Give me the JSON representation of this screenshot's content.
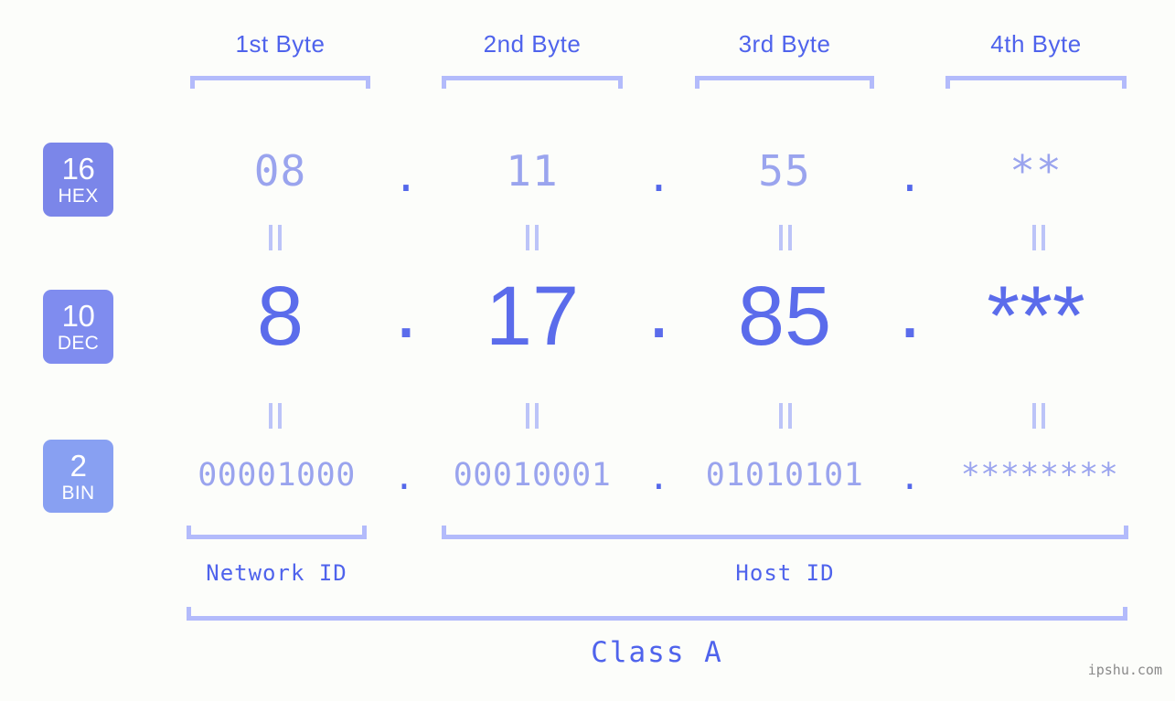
{
  "theme": {
    "background": "#fcfdfa",
    "accent_strong": "#4f63ec",
    "accent_dec": "#5b6ceb",
    "accent_light": "#9aa4ee",
    "bracket": "#b3bbfb",
    "badge_hex": "#7b86e9",
    "badge_dec": "#7f8cef",
    "badge_bin": "#88a0f2",
    "watermark": "#8a8a8a"
  },
  "byte_headers": [
    {
      "label": "1st Byte"
    },
    {
      "label": "2nd Byte"
    },
    {
      "label": "3rd Byte"
    },
    {
      "label": "4th Byte"
    }
  ],
  "bases": [
    {
      "number": "16",
      "name": "HEX"
    },
    {
      "number": "10",
      "name": "DEC"
    },
    {
      "number": "2",
      "name": "BIN"
    }
  ],
  "rows": {
    "hex": {
      "base_number": "16",
      "base_name": "HEX",
      "values": [
        "08",
        "11",
        "55",
        "**"
      ],
      "separators": [
        ".",
        ".",
        "."
      ]
    },
    "dec": {
      "base_number": "10",
      "base_name": "DEC",
      "values": [
        "8",
        "17",
        "85",
        "***"
      ],
      "separators": [
        ".",
        ".",
        "."
      ]
    },
    "bin": {
      "base_number": "2",
      "base_name": "BIN",
      "values": [
        "00001000",
        "00010001",
        "01010101",
        "********"
      ],
      "separators": [
        ".",
        ".",
        "."
      ]
    }
  },
  "equals_marks": {
    "glyph": "||",
    "count_per_gap": 4,
    "gaps": 2
  },
  "segments": {
    "network_id": "Network ID",
    "host_id": "Host ID"
  },
  "class_label": "Class A",
  "watermark": "ipshu.com"
}
